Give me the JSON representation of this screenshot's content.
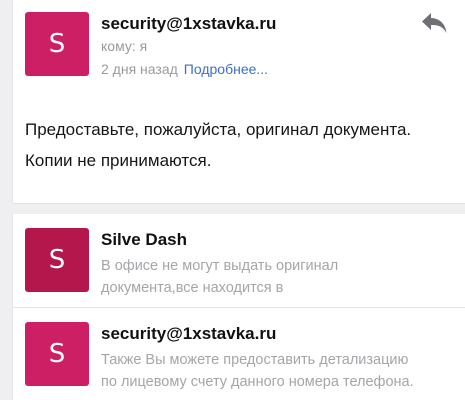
{
  "colors": {
    "avatar_bright": "#cc1f64",
    "avatar_dark": "#b3174b",
    "link": "#3d6fc5",
    "meta": "#9a9a9f",
    "background": "#efeff1"
  },
  "open_message": {
    "avatar_letter": "S",
    "sender": "security@1xstavka.ru",
    "recipient": "кому: я",
    "date": "2 дня назад",
    "more_link": "Подробнее...",
    "reply_icon": "reply-arrow-icon",
    "body_line_1": "Предоставьте, пожалуйста, оригинал документа.",
    "body_line_2": "Копии не принимаются."
  },
  "thread": [
    {
      "avatar_letter": "S",
      "sender": "Silve Dash",
      "preview": "В офисе не могут выдать оригинал документа,все находится в"
    },
    {
      "avatar_letter": "S",
      "sender": "security@1xstavka.ru",
      "preview": "Также Вы можете предоставить детализацию по лицевому счету данного номера телефона."
    }
  ]
}
